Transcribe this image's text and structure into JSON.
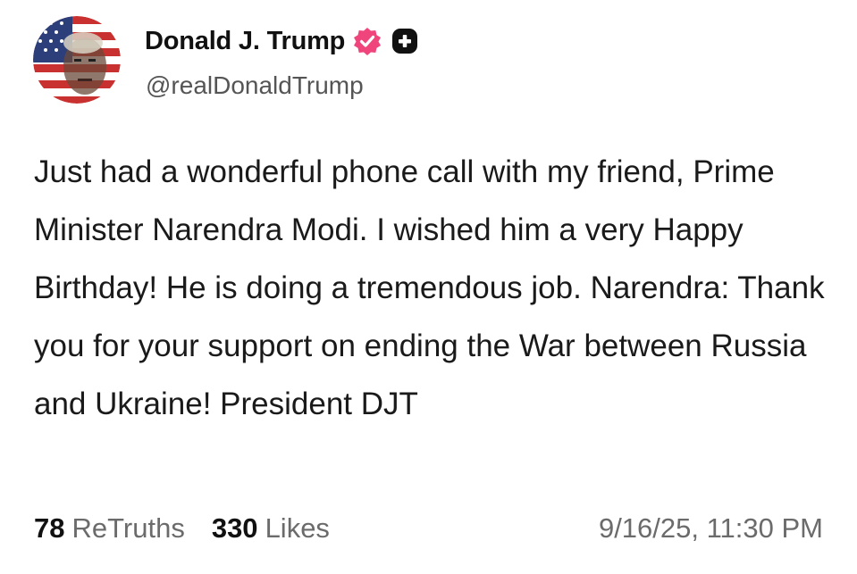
{
  "author": {
    "display_name": "Donald J. Trump",
    "handle": "@realDonaldTrump",
    "avatar_icon": "profile-avatar-flag-portrait",
    "verified_icon": "verified-badge-icon",
    "verified_color": "#f0457c",
    "plus_icon": "plus-badge-icon"
  },
  "post": {
    "text": "Just had a wonderful phone call with my friend, Prime Minister Narendra Modi. I wished him a very Happy Birthday! He is doing a tremendous job. Narendra: Thank you for your support on ending the War between Russia and Ukraine! President DJT"
  },
  "stats": {
    "retruths_count": "78",
    "retruths_label": "ReTruths",
    "likes_count": "330",
    "likes_label": "Likes"
  },
  "timestamp": "9/16/25, 11:30 PM"
}
